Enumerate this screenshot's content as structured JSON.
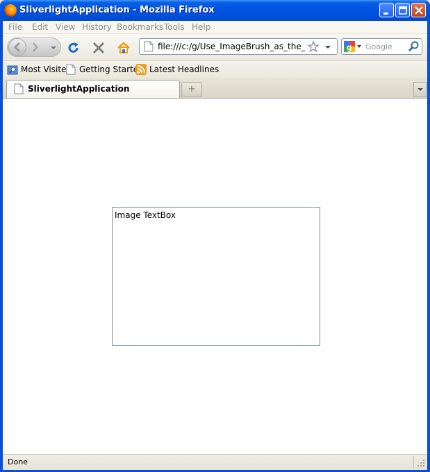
{
  "window": {
    "title": "SliverlightApplication - Mozilla Firefox"
  },
  "menu": {
    "items": [
      "File",
      "Edit",
      "View",
      "History",
      "Bookmarks",
      "Tools",
      "Help"
    ]
  },
  "navigation": {
    "url": "file:///c:/g/Use_ImageBrush_as_the_TextBox",
    "search_placeholder": "Google"
  },
  "bookmarks": {
    "items": [
      "Most Visited",
      "Getting Started",
      "Latest Headlines"
    ]
  },
  "tabs": {
    "active_label": "SliverlightApplication",
    "new_tab_glyph": "+"
  },
  "content": {
    "textbox_text": "Image TextBox"
  },
  "status": {
    "text": "Done"
  },
  "colors": {
    "titlebar": "#0050dc",
    "reload": "#1e6bc8",
    "stop": "#7d7d7d",
    "home": "#e8a11c",
    "rss": "#f29b1b"
  }
}
